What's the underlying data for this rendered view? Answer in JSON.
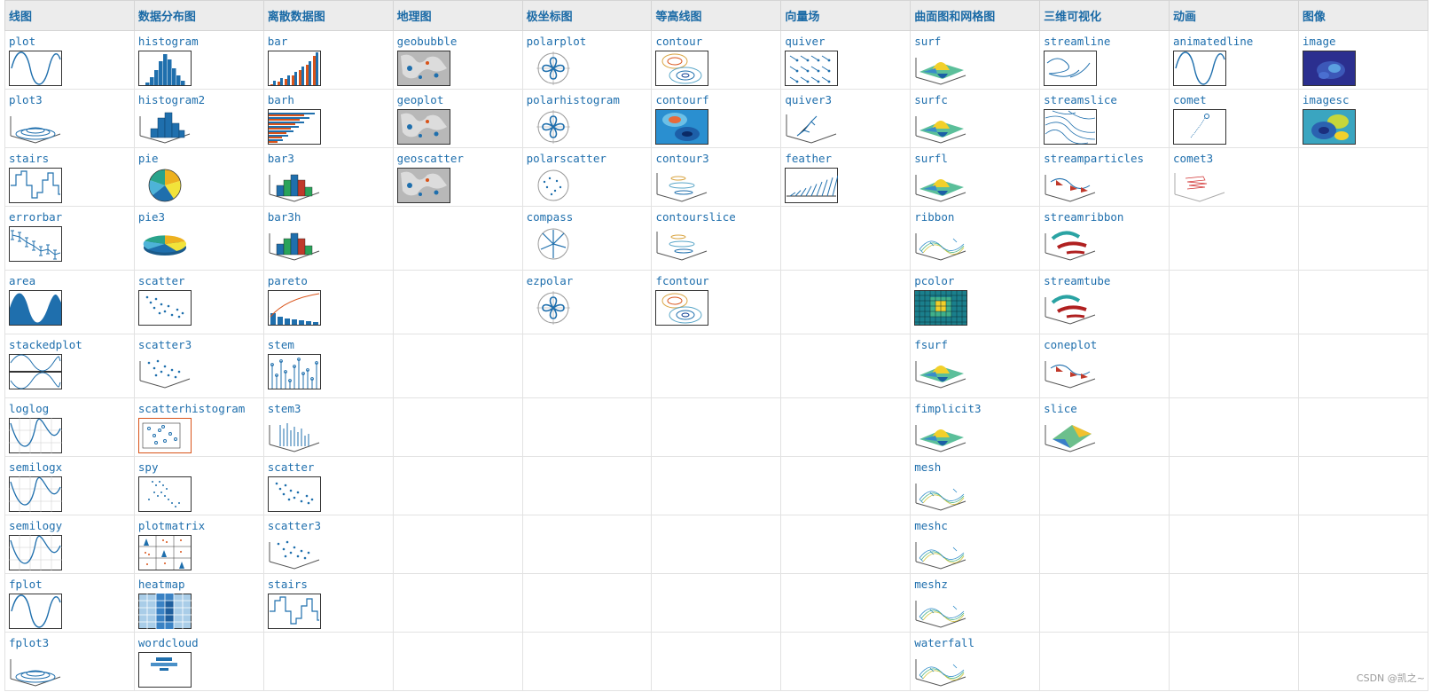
{
  "headers": [
    "线图",
    "数据分布图",
    "离散数据图",
    "地理图",
    "极坐标图",
    "等高线图",
    "向量场",
    "曲面图和网格图",
    "三维可视化",
    "动画",
    "图像"
  ],
  "row_heights": [
    66,
    66,
    66,
    72,
    72,
    72,
    66,
    66,
    66,
    66,
    66
  ],
  "rows": [
    [
      [
        "plot",
        "line"
      ],
      [
        "histogram",
        "hist"
      ],
      [
        "bar",
        "bar"
      ],
      [
        "geobubble",
        "geo"
      ],
      [
        "polarplot",
        "polar"
      ],
      [
        "contour",
        "contour"
      ],
      [
        "quiver",
        "quiver"
      ],
      [
        "surf",
        "surf"
      ],
      [
        "streamline",
        "stream"
      ],
      [
        "animatedline",
        "line"
      ],
      [
        "image",
        "image"
      ]
    ],
    [
      [
        "plot3",
        "spiral"
      ],
      [
        "histogram2",
        "hist2"
      ],
      [
        "barh",
        "barh"
      ],
      [
        "geoplot",
        "geo"
      ],
      [
        "polarhistogram",
        "polar"
      ],
      [
        "contourf",
        "contourf"
      ],
      [
        "quiver3",
        "quiver3"
      ],
      [
        "surfc",
        "surf"
      ],
      [
        "streamslice",
        "streamslice"
      ],
      [
        "comet",
        "comet"
      ],
      [
        "imagesc",
        "image2"
      ]
    ],
    [
      [
        "stairs",
        "stairs"
      ],
      [
        "pie",
        "pie"
      ],
      [
        "bar3",
        "bar3"
      ],
      [
        "geoscatter",
        "geo"
      ],
      [
        "polarscatter",
        "polarscatter"
      ],
      [
        "contour3",
        "contour3"
      ],
      [
        "feather",
        "feather"
      ],
      [
        "surfl",
        "surf"
      ],
      [
        "streamparticles",
        "axes3"
      ],
      [
        "comet3",
        "comet3"
      ],
      null
    ],
    [
      [
        "errorbar",
        "errorbar"
      ],
      [
        "pie3",
        "pie3"
      ],
      [
        "bar3h",
        "bar3"
      ],
      null,
      [
        "compass",
        "compass"
      ],
      [
        "contourslice",
        "contour3"
      ],
      null,
      [
        "ribbon",
        "mesh"
      ],
      [
        "streamribbon",
        "tube"
      ],
      null,
      null
    ],
    [
      [
        "area",
        "area"
      ],
      [
        "scatter",
        "scatter"
      ],
      [
        "pareto",
        "pareto"
      ],
      null,
      [
        "ezpolar",
        "polar"
      ],
      [
        "fcontour",
        "contour"
      ],
      null,
      [
        "pcolor",
        "pcolor"
      ],
      [
        "streamtube",
        "tube"
      ],
      null,
      null
    ],
    [
      [
        "stackedplot",
        "stacked"
      ],
      [
        "scatter3",
        "scatter3"
      ],
      [
        "stem",
        "stem"
      ],
      null,
      null,
      null,
      null,
      [
        "fsurf",
        "surf"
      ],
      [
        "coneplot",
        "axes3"
      ],
      null,
      null
    ],
    [
      [
        "loglog",
        "loglog"
      ],
      [
        "scatterhistogram",
        "scatterhist"
      ],
      [
        "stem3",
        "stem3"
      ],
      null,
      null,
      null,
      null,
      [
        "fimplicit3",
        "surf"
      ],
      [
        "slice",
        "slice"
      ],
      null,
      null
    ],
    [
      [
        "semilogx",
        "loglog"
      ],
      [
        "spy",
        "spy"
      ],
      [
        "scatter",
        "scatter"
      ],
      null,
      null,
      null,
      null,
      [
        "mesh",
        "mesh"
      ],
      null,
      null,
      null
    ],
    [
      [
        "semilogy",
        "loglog"
      ],
      [
        "plotmatrix",
        "plotmatrix"
      ],
      [
        "scatter3",
        "scatter3"
      ],
      null,
      null,
      null,
      null,
      [
        "meshc",
        "mesh"
      ],
      null,
      null,
      null
    ],
    [
      [
        "fplot",
        "line"
      ],
      [
        "heatmap",
        "heatmap"
      ],
      [
        "stairs",
        "stairs"
      ],
      null,
      null,
      null,
      null,
      [
        "meshz",
        "mesh"
      ],
      null,
      null,
      null
    ],
    [
      [
        "fplot3",
        "spiral"
      ],
      [
        "wordcloud",
        "wordcloud"
      ],
      null,
      null,
      null,
      null,
      null,
      [
        "waterfall",
        "mesh"
      ],
      null,
      null,
      null
    ]
  ],
  "watermark": "CSDN @凯之~"
}
